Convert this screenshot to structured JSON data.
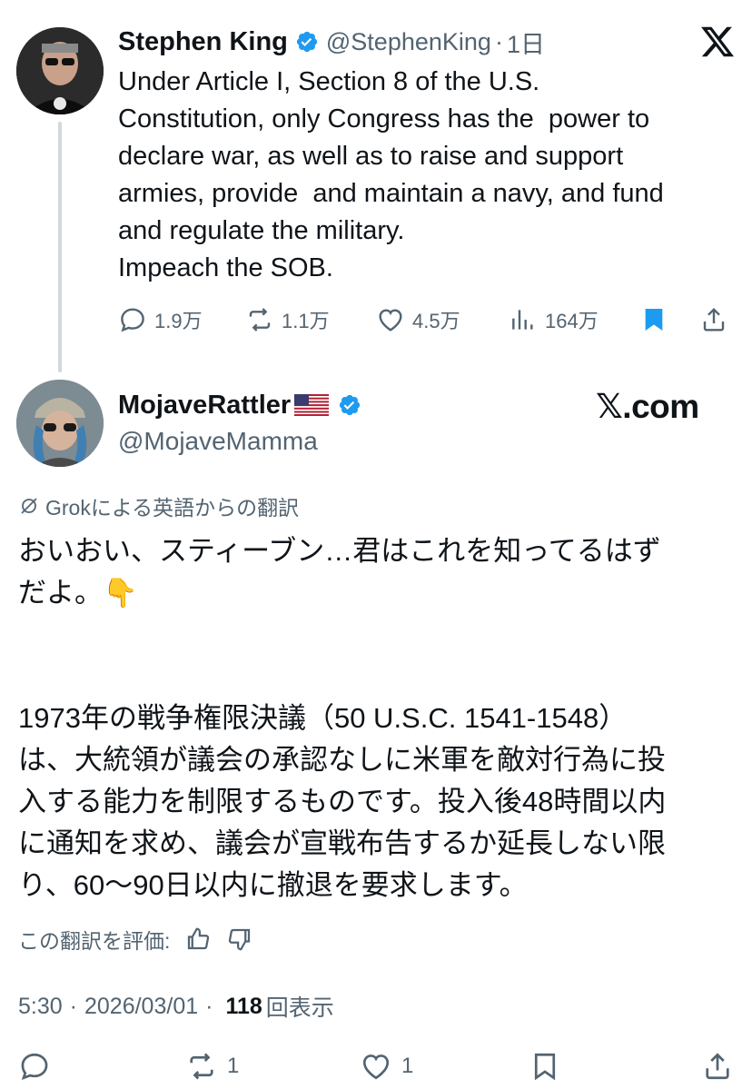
{
  "parent_tweet": {
    "author_name": "Stephen King",
    "handle": "@StephenKing",
    "separator": "·",
    "time": "1日",
    "text": "Under Article I, Section 8 of the U.S.\nConstitution, only Congress has the  power to\ndeclare war, as well as to raise and support\narmies, provide  and maintain a navy, and fund\nand regulate the military.\nImpeach the SOB.",
    "actions": {
      "reply_count": "1.9万",
      "retweet_count": "1.1万",
      "like_count": "4.5万",
      "views_count": "164万"
    },
    "icons": [
      "verified-badge-icon",
      "x-logo-icon",
      "reply-icon",
      "retweet-icon",
      "like-icon",
      "views-icon",
      "bookmark-icon",
      "share-icon"
    ]
  },
  "reply_tweet": {
    "author_name": "MojaveRattler",
    "flag": "🇺🇸",
    "handle": "@MojaveMamma",
    "watermark": "𝕏.com",
    "translation_label": "Grokによる英語からの翻訳",
    "text": "おいおい、スティーブン…君はこれを知ってるはず\nだよ。👇\n\n\n1973年の戦争権限決議（50 U.S.C. 1541-1548）\nは、大統領が議会の承認なしに米軍を敵対行為に投\n入する能力を制限するものです。投入後48時間以内\nに通知を求め、議会が宣戦布告するか延長しない限\nり、60〜90日以内に撤退を要求します。",
    "rate_label": "この翻訳を評価:",
    "time": "5:30",
    "date": "2026/03/01",
    "meta_sep": "·",
    "views": "118",
    "views_label": "回表示",
    "actions": {
      "retweet_count": "1",
      "like_count": "1"
    }
  },
  "colors": {
    "text_primary": "#0f1419",
    "text_secondary": "#536471",
    "verified_blue": "#1d9bf0",
    "bookmark_blue": "#1d9bf0",
    "thread_line": "#cfd9de"
  }
}
